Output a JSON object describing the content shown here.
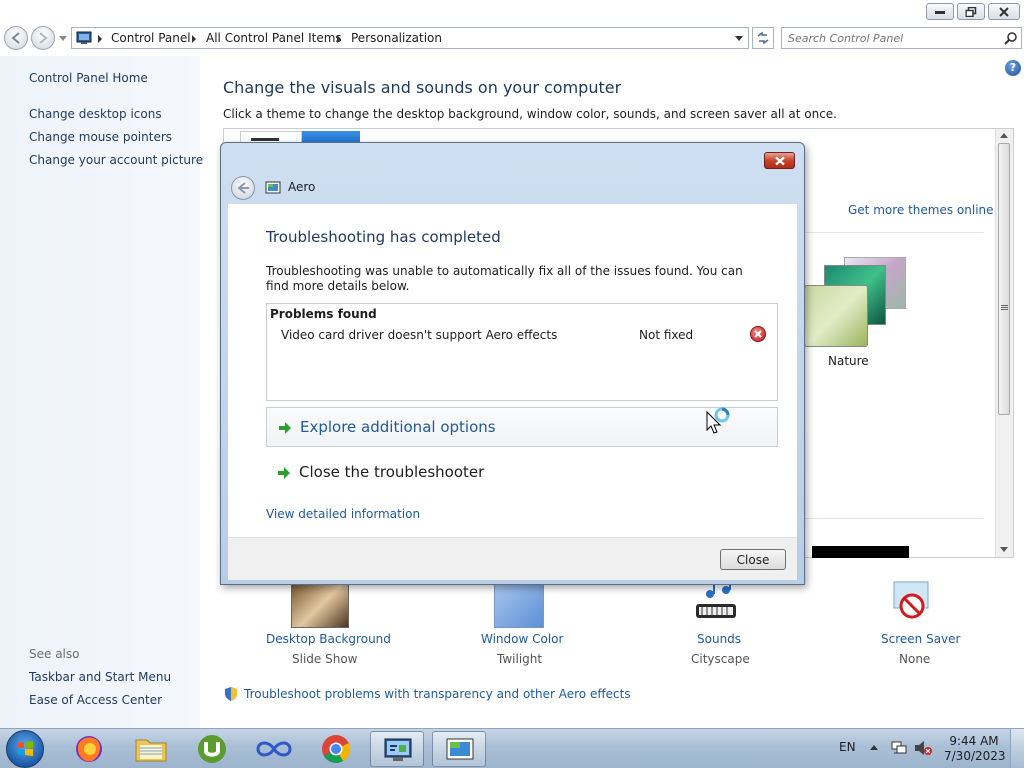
{
  "window": {
    "controls": {
      "minimize": "minimize",
      "maximize": "maximize",
      "close": "close"
    }
  },
  "address": {
    "crumbs": [
      "Control Panel",
      "All Control Panel Items",
      "Personalization"
    ],
    "search_placeholder": "Search Control Panel"
  },
  "sidebar": {
    "home": "Control Panel Home",
    "links": [
      "Change desktop icons",
      "Change mouse pointers",
      "Change your account picture"
    ],
    "see_also_title": "See also",
    "see_also": [
      "Taskbar and Start Menu",
      "Ease of Access Center"
    ]
  },
  "main": {
    "title": "Change the visuals and sounds on your computer",
    "subtitle": "Click a theme to change the desktop background, window color, sounds, and screen saver all at once.",
    "get_more": "Get more themes online",
    "theme_name": "Nature",
    "bottom_items": [
      {
        "label": "Desktop Background",
        "value": "Slide Show"
      },
      {
        "label": "Window Color",
        "value": "Twilight"
      },
      {
        "label": "Sounds",
        "value": "Cityscape"
      },
      {
        "label": "Screen Saver",
        "value": "None"
      }
    ],
    "aero_link": "Troubleshoot problems with transparency and other Aero effects"
  },
  "dialog": {
    "app_title": "Aero",
    "heading": "Troubleshooting has completed",
    "description": "Troubleshooting was unable to automatically fix all of the issues found. You can find more details below.",
    "problems_header": "Problems found",
    "problems": [
      {
        "issue": "Video card driver doesn't support Aero effects",
        "status": "Not fixed"
      }
    ],
    "explore": "Explore additional options",
    "close_troubleshooter": "Close the troubleshooter",
    "detail_link": "View detailed information",
    "close_button": "Close"
  },
  "taskbar": {
    "language": "EN",
    "time": "9:44 AM",
    "date": "7/30/2023"
  },
  "colors": {
    "link": "#1e5a9c",
    "heading": "#1e395b",
    "command_arrow": "#2ca02c"
  }
}
